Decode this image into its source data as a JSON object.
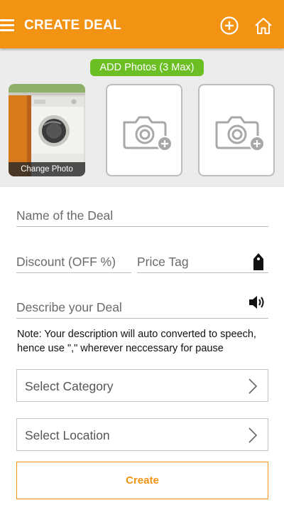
{
  "header": {
    "title": "CREATE DEAL",
    "menu_icon": "menu-icon",
    "add_icon": "plus-circle-icon",
    "home_icon": "home-icon",
    "background": "#f29314"
  },
  "photos": {
    "add_label": "ADD Photos (3 Max)",
    "badge_color": "#6bbf24",
    "slots": [
      {
        "state": "filled",
        "image": "washing-machine",
        "overlay_label": "Change Photo"
      },
      {
        "state": "empty",
        "icon": "camera-add-icon"
      },
      {
        "state": "empty",
        "icon": "camera-add-icon"
      }
    ]
  },
  "form": {
    "deal_name_placeholder": "Name of the Deal",
    "discount_placeholder": "Discount (OFF %)",
    "price_placeholder": "Price Tag",
    "price_icon": "price-tag-icon",
    "description_placeholder": "Describe your Deal",
    "speaker_icon": "speaker-icon",
    "note": "Note: Your description will auto converted to speech, hence use \",\" wherever neccessary for pause",
    "category_label": "Select Category",
    "location_label": "Select Location",
    "chevron_icon": "chevron-right-icon",
    "create_label": "Create",
    "accent": "#f29314"
  }
}
